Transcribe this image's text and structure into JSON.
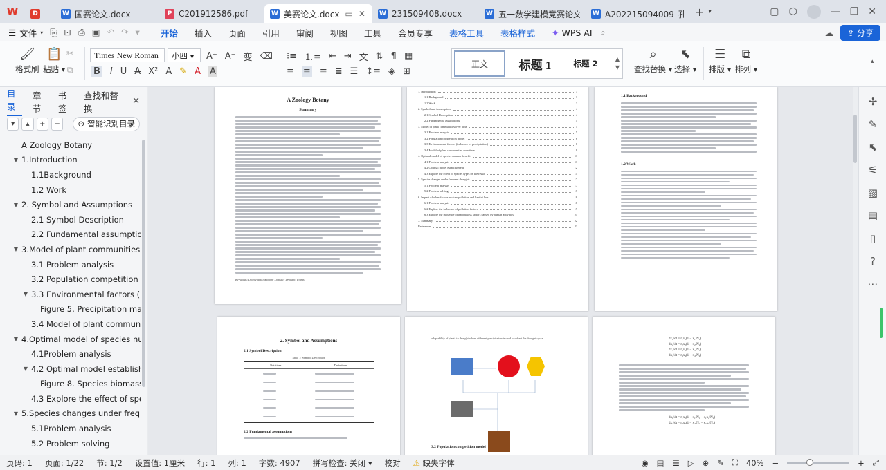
{
  "tabs": [
    {
      "label": "国赛论文.docx",
      "type": "W",
      "color": "#2b6dd6",
      "active": false
    },
    {
      "label": "C201912586.pdf",
      "type": "P",
      "color": "#e0435a",
      "active": false
    },
    {
      "label": "美赛论文.docx",
      "type": "W",
      "color": "#2b6dd6",
      "active": true
    },
    {
      "label": "231509408.docx",
      "type": "W",
      "color": "#2b6dd6",
      "active": false
    },
    {
      "label": "五一数学建模竞赛论文模板",
      "type": "W",
      "color": "#2b6dd6",
      "active": false
    },
    {
      "label": "A202215094009_孔欣",
      "type": "W",
      "color": "#2b6dd6",
      "active": false
    }
  ],
  "menu": {
    "file": "文件",
    "items": [
      "开始",
      "插入",
      "页面",
      "引用",
      "审阅",
      "视图",
      "工具",
      "会员专享"
    ],
    "active": "开始",
    "tools": [
      "表格工具",
      "表格样式"
    ],
    "wps_ai": "WPS AI",
    "share": "分享"
  },
  "ribbon": {
    "format_painter": "格式刷",
    "paste": "粘贴",
    "font_name": "Times New Roman",
    "font_size": "小四",
    "styles": {
      "normal": "正文",
      "h1": "标题 1",
      "h2": "标题 2"
    },
    "find_replace": "查找替换",
    "select": "选择",
    "layout": "排版",
    "arrange": "排列"
  },
  "nav": {
    "tabs": [
      "目录",
      "章节",
      "书签",
      "查找和替换"
    ],
    "smart_btn": "智能识别目录",
    "toc": [
      {
        "label": "A Zoology Botany",
        "level": 0,
        "arrow": ""
      },
      {
        "label": "1.Introduction",
        "level": 0,
        "arrow": "▼"
      },
      {
        "label": "1.1Background",
        "level": 1,
        "arrow": ""
      },
      {
        "label": "1.2 Work",
        "level": 1,
        "arrow": ""
      },
      {
        "label": "2. Symbol and Assumptions",
        "level": 0,
        "arrow": "▼"
      },
      {
        "label": "2.1 Symbol Description",
        "level": 1,
        "arrow": ""
      },
      {
        "label": "2.2 Fundamental assumption…",
        "level": 1,
        "arrow": ""
      },
      {
        "label": "3.Model of plant communities o…",
        "level": 0,
        "arrow": "▼"
      },
      {
        "label": "3.1 Problem analysis",
        "level": 1,
        "arrow": ""
      },
      {
        "label": "3.2 Population competition …",
        "level": 1,
        "arrow": ""
      },
      {
        "label": "3.3 Environmental factors (inf…",
        "level": 1,
        "arrow": "▼"
      },
      {
        "label": "Figure 5. Precipitation ma…",
        "level": 2,
        "arrow": ""
      },
      {
        "label": "3.4 Model of plant communit…",
        "level": 1,
        "arrow": ""
      },
      {
        "label": "4.Optimal model of species num…",
        "level": 0,
        "arrow": "▼"
      },
      {
        "label": "4.1Problem analysis",
        "level": 1,
        "arrow": ""
      },
      {
        "label": "4.2 Optimal model establish…",
        "level": 1,
        "arrow": "▼"
      },
      {
        "label": "Figure 8. Species biomass …",
        "level": 2,
        "arrow": ""
      },
      {
        "label": "4.3 Explore the effect of speci…",
        "level": 1,
        "arrow": ""
      },
      {
        "label": "5.Species changes under freque…",
        "level": 0,
        "arrow": "▼"
      },
      {
        "label": "5.1Problem analysis",
        "level": 1,
        "arrow": ""
      },
      {
        "label": "5.2 Problem solving",
        "level": 1,
        "arrow": ""
      }
    ]
  },
  "pages": {
    "p1": {
      "title": "A Zoology Botany",
      "subtitle": "Summary",
      "keywords": "Keywords: Differential equation; Logistic; Drought; Plants"
    },
    "p2": {
      "toc": [
        {
          "label": "1. Introduction",
          "page": "3"
        },
        {
          "label": "1.1 Background",
          "page": "3"
        },
        {
          "label": "1.2 Work",
          "page": "3"
        },
        {
          "label": "2. Symbol and Assumptions",
          "page": "4"
        },
        {
          "label": "2.1 Symbol Description",
          "page": "4"
        },
        {
          "label": "2.2 Fundamental assumptions",
          "page": "4"
        },
        {
          "label": "3. Model of plant communities over time",
          "page": "5"
        },
        {
          "label": "3.1 Problem analysis",
          "page": "5"
        },
        {
          "label": "3.2 Population competition model",
          "page": "6"
        },
        {
          "label": "3.3 Environmental factors (influence of precipitation)",
          "page": "8"
        },
        {
          "label": "3.4 Model of plant communities over time",
          "page": "9"
        },
        {
          "label": "4. Optimal model of species number benefit",
          "page": "11"
        },
        {
          "label": "4.1 Problem analysis",
          "page": "11"
        },
        {
          "label": "4.2 Optimal model establishment",
          "page": "12"
        },
        {
          "label": "4.3 Explore the effect of species types on the result",
          "page": "14"
        },
        {
          "label": "5. Species changes under frequent droughts",
          "page": "17"
        },
        {
          "label": "5.1 Problem analysis",
          "page": "17"
        },
        {
          "label": "5.2 Problem solving",
          "page": "17"
        },
        {
          "label": "6. Impact of other factors such as pollution and habitat loss",
          "page": "18"
        },
        {
          "label": "6.1 Problem analysis",
          "page": "18"
        },
        {
          "label": "6.2 Explore the influence of pollution factors",
          "page": "19"
        },
        {
          "label": "6.3 Explore the influence of habitat loss factors caused by human activities",
          "page": "21"
        },
        {
          "label": "7. Summary",
          "page": "22"
        },
        {
          "label": "References",
          "page": "23"
        }
      ]
    },
    "p3": {
      "sec1": "1.1 Background",
      "sec2": "1.2 Work"
    },
    "p4": {
      "title": "2. Symbol and Assumptions",
      "sec1": "2.1 Symbol Description",
      "table_caption": "Table 1: Symbol Description",
      "col1": "Notations",
      "col2": "Definitions",
      "sec2": "2.2 Fundamental assumptions"
    },
    "p5": {
      "intro": "adaptability of plants to drought where different precipitation is used to reflect the drought cycle",
      "sec": "3.2 Population competition model"
    },
    "p6": {}
  },
  "status": {
    "page_no": "页码: 1",
    "page_of": "页面: 1/22",
    "section": "节: 1/2",
    "setting": "设置值: 1厘米",
    "row": "行: 1",
    "col": "列: 1",
    "words": "字数: 4907",
    "spell": "拼写检查: 关闭",
    "proof": "校对",
    "missing_font": "缺失字体",
    "zoom": "40%"
  },
  "colors": {
    "accent": "#1a64d8",
    "flow_blue": "#4a7cc9",
    "flow_red": "#e3101c",
    "flow_yellow": "#f5c400",
    "flow_gray": "#6b6b6b",
    "flow_brown": "#8a4a1c"
  }
}
